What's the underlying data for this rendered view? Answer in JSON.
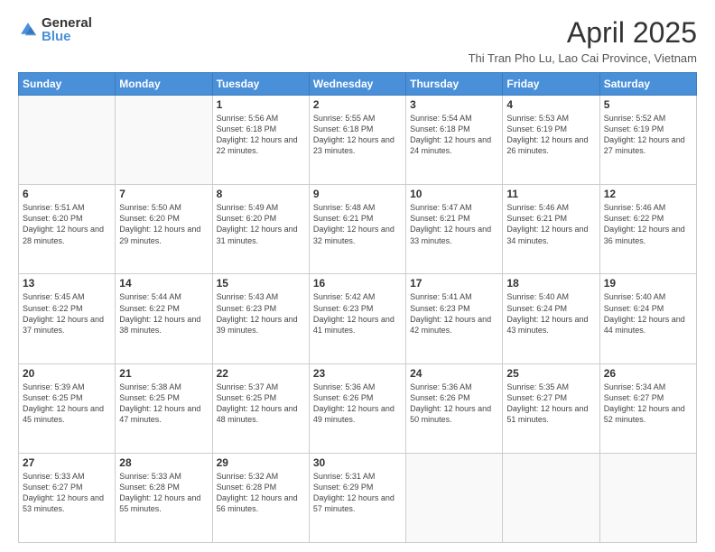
{
  "logo": {
    "general": "General",
    "blue": "Blue"
  },
  "title": "April 2025",
  "subtitle": "Thi Tran Pho Lu, Lao Cai Province, Vietnam",
  "headers": [
    "Sunday",
    "Monday",
    "Tuesday",
    "Wednesday",
    "Thursday",
    "Friday",
    "Saturday"
  ],
  "weeks": [
    [
      {
        "day": "",
        "info": ""
      },
      {
        "day": "",
        "info": ""
      },
      {
        "day": "1",
        "info": "Sunrise: 5:56 AM\nSunset: 6:18 PM\nDaylight: 12 hours and 22 minutes."
      },
      {
        "day": "2",
        "info": "Sunrise: 5:55 AM\nSunset: 6:18 PM\nDaylight: 12 hours and 23 minutes."
      },
      {
        "day": "3",
        "info": "Sunrise: 5:54 AM\nSunset: 6:18 PM\nDaylight: 12 hours and 24 minutes."
      },
      {
        "day": "4",
        "info": "Sunrise: 5:53 AM\nSunset: 6:19 PM\nDaylight: 12 hours and 26 minutes."
      },
      {
        "day": "5",
        "info": "Sunrise: 5:52 AM\nSunset: 6:19 PM\nDaylight: 12 hours and 27 minutes."
      }
    ],
    [
      {
        "day": "6",
        "info": "Sunrise: 5:51 AM\nSunset: 6:20 PM\nDaylight: 12 hours and 28 minutes."
      },
      {
        "day": "7",
        "info": "Sunrise: 5:50 AM\nSunset: 6:20 PM\nDaylight: 12 hours and 29 minutes."
      },
      {
        "day": "8",
        "info": "Sunrise: 5:49 AM\nSunset: 6:20 PM\nDaylight: 12 hours and 31 minutes."
      },
      {
        "day": "9",
        "info": "Sunrise: 5:48 AM\nSunset: 6:21 PM\nDaylight: 12 hours and 32 minutes."
      },
      {
        "day": "10",
        "info": "Sunrise: 5:47 AM\nSunset: 6:21 PM\nDaylight: 12 hours and 33 minutes."
      },
      {
        "day": "11",
        "info": "Sunrise: 5:46 AM\nSunset: 6:21 PM\nDaylight: 12 hours and 34 minutes."
      },
      {
        "day": "12",
        "info": "Sunrise: 5:46 AM\nSunset: 6:22 PM\nDaylight: 12 hours and 36 minutes."
      }
    ],
    [
      {
        "day": "13",
        "info": "Sunrise: 5:45 AM\nSunset: 6:22 PM\nDaylight: 12 hours and 37 minutes."
      },
      {
        "day": "14",
        "info": "Sunrise: 5:44 AM\nSunset: 6:22 PM\nDaylight: 12 hours and 38 minutes."
      },
      {
        "day": "15",
        "info": "Sunrise: 5:43 AM\nSunset: 6:23 PM\nDaylight: 12 hours and 39 minutes."
      },
      {
        "day": "16",
        "info": "Sunrise: 5:42 AM\nSunset: 6:23 PM\nDaylight: 12 hours and 41 minutes."
      },
      {
        "day": "17",
        "info": "Sunrise: 5:41 AM\nSunset: 6:23 PM\nDaylight: 12 hours and 42 minutes."
      },
      {
        "day": "18",
        "info": "Sunrise: 5:40 AM\nSunset: 6:24 PM\nDaylight: 12 hours and 43 minutes."
      },
      {
        "day": "19",
        "info": "Sunrise: 5:40 AM\nSunset: 6:24 PM\nDaylight: 12 hours and 44 minutes."
      }
    ],
    [
      {
        "day": "20",
        "info": "Sunrise: 5:39 AM\nSunset: 6:25 PM\nDaylight: 12 hours and 45 minutes."
      },
      {
        "day": "21",
        "info": "Sunrise: 5:38 AM\nSunset: 6:25 PM\nDaylight: 12 hours and 47 minutes."
      },
      {
        "day": "22",
        "info": "Sunrise: 5:37 AM\nSunset: 6:25 PM\nDaylight: 12 hours and 48 minutes."
      },
      {
        "day": "23",
        "info": "Sunrise: 5:36 AM\nSunset: 6:26 PM\nDaylight: 12 hours and 49 minutes."
      },
      {
        "day": "24",
        "info": "Sunrise: 5:36 AM\nSunset: 6:26 PM\nDaylight: 12 hours and 50 minutes."
      },
      {
        "day": "25",
        "info": "Sunrise: 5:35 AM\nSunset: 6:27 PM\nDaylight: 12 hours and 51 minutes."
      },
      {
        "day": "26",
        "info": "Sunrise: 5:34 AM\nSunset: 6:27 PM\nDaylight: 12 hours and 52 minutes."
      }
    ],
    [
      {
        "day": "27",
        "info": "Sunrise: 5:33 AM\nSunset: 6:27 PM\nDaylight: 12 hours and 53 minutes."
      },
      {
        "day": "28",
        "info": "Sunrise: 5:33 AM\nSunset: 6:28 PM\nDaylight: 12 hours and 55 minutes."
      },
      {
        "day": "29",
        "info": "Sunrise: 5:32 AM\nSunset: 6:28 PM\nDaylight: 12 hours and 56 minutes."
      },
      {
        "day": "30",
        "info": "Sunrise: 5:31 AM\nSunset: 6:29 PM\nDaylight: 12 hours and 57 minutes."
      },
      {
        "day": "",
        "info": ""
      },
      {
        "day": "",
        "info": ""
      },
      {
        "day": "",
        "info": ""
      }
    ]
  ]
}
